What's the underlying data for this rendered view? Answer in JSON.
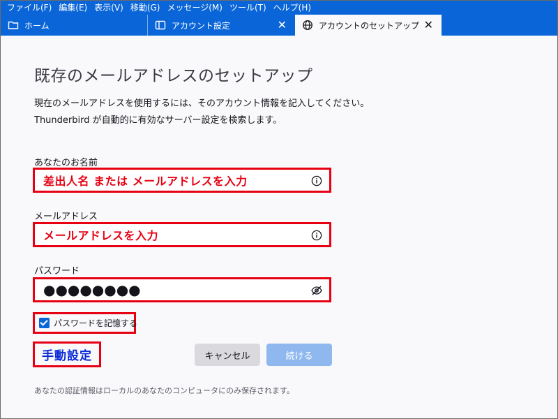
{
  "menubar": {
    "items": [
      "ファイル(F)",
      "編集(E)",
      "表示(V)",
      "移動(G)",
      "メッセージ(M)",
      "ツール(T)",
      "ヘルプ(H)"
    ]
  },
  "tabs": {
    "home": "ホーム",
    "account_settings": "アカウント設定",
    "account_setup": "アカウントのセットアップ",
    "close_glyph": "✕"
  },
  "page": {
    "title": "既存のメールアドレスのセットアップ",
    "description_line1": "現在のメールアドレスを使用するには、そのアカウント情報を記入してください。",
    "description_line2": "Thunderbird が自動的に有効なサーバー設定を検索します。"
  },
  "form": {
    "name_label": "あなたのお名前",
    "name_value": "差出人名 または メールアドレスを入力",
    "email_label": "メールアドレス",
    "email_value": "メールアドレスを入力",
    "password_label": "パスワード",
    "password_value": "●●●●●●●●",
    "remember_label": "パスワードを記憶する",
    "remember_checked": true
  },
  "actions": {
    "manual_label": "手動設定",
    "cancel_label": "キャンセル",
    "continue_label": "続ける"
  },
  "footer": {
    "note": "あなたの認証情報はローカルのあなたのコンピュータにのみ保存されます。"
  },
  "colors": {
    "accent": "#0a66d8",
    "annotation_red": "#e60012",
    "annotation_blue": "#0a2ad8"
  }
}
